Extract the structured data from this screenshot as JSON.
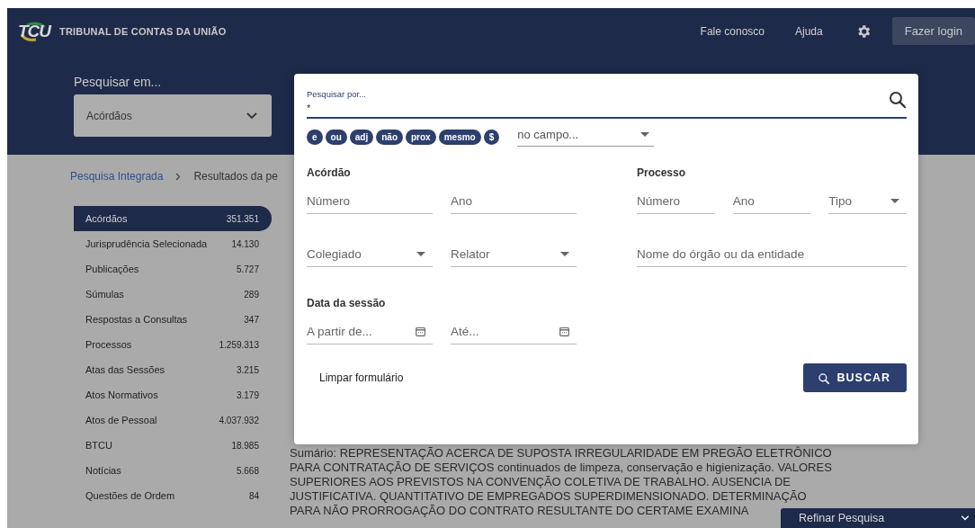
{
  "header": {
    "logo_mark": "TCU",
    "logo_text": "TRIBUNAL DE CONTAS DA UNIÃO",
    "links": [
      "Fale conosco",
      "Ajuda"
    ],
    "login_button": "Fazer login"
  },
  "search_scope": {
    "label": "Pesquisar em...",
    "value": "Acórdãos"
  },
  "breadcrumb": [
    {
      "label": "Pesquisa Integrada",
      "kind": "link"
    },
    {
      "label": "Resultados da pe",
      "kind": "current"
    }
  ],
  "sidebar": {
    "items": [
      {
        "label": "Acórdãos",
        "count": "351.351",
        "selected": true
      },
      {
        "label": "Jurisprudência Selecionada",
        "count": "14.130",
        "selected": false
      },
      {
        "label": "Publicações",
        "count": "5.727",
        "selected": false
      },
      {
        "label": "Súmulas",
        "count": "289",
        "selected": false
      },
      {
        "label": "Respostas a Consultas",
        "count": "347",
        "selected": false
      },
      {
        "label": "Processos",
        "count": "1.259.313",
        "selected": false
      },
      {
        "label": "Atas das Sessões",
        "count": "3.215",
        "selected": false
      },
      {
        "label": "Atos Normativos",
        "count": "3.179",
        "selected": false
      },
      {
        "label": "Atos de Pessoal",
        "count": "4.037.932",
        "selected": false
      },
      {
        "label": "BTCU",
        "count": "18.985",
        "selected": false
      },
      {
        "label": "Notícias",
        "count": "5.668",
        "selected": false
      },
      {
        "label": "Questões de Ordem",
        "count": "84",
        "selected": false
      }
    ]
  },
  "summary_lines": [
    "Sumário: REPRESENTAÇÃO ACERCA DE SUPOSTA IRREGULARIDADE EM PREGÃO ELETRÔNICO",
    "PARA CONTRATAÇÃO DE SERVIÇOS continuados de limpeza, conservação e higienização. VALORES",
    "SUPERIORES AOS PREVISTOS NA CONVENÇÃO COLETIVA DE TRABALHO. AUSENCIA DE",
    "JUSTIFICATIVA. QUANTITATIVO DE EMPREGADOS SUPERDIMENSIONADO. DETERMINAÇÃO",
    "PARA NÃO PRORROGAÇÃO DO CONTRATO RESULTANTE DO CERTAME EXAMINA"
  ],
  "modal": {
    "search": {
      "label": "Pesquisar por...",
      "value": "*"
    },
    "operators": [
      "e",
      "ou",
      "adj",
      "não",
      "prox",
      "mesmo",
      "$"
    ],
    "field_select": {
      "placeholder": "no campo..."
    },
    "groups": [
      {
        "title": "Acórdão",
        "rows": [
          [
            {
              "kind": "text",
              "placeholder": "Número"
            },
            {
              "kind": "text",
              "placeholder": "Ano"
            }
          ],
          [
            {
              "kind": "select",
              "placeholder": "Colegiado"
            },
            {
              "kind": "select",
              "placeholder": "Relator"
            }
          ]
        ]
      },
      {
        "title": "Processo",
        "rows": [
          [
            {
              "kind": "text",
              "placeholder": "Número"
            },
            {
              "kind": "text",
              "placeholder": "Ano"
            },
            {
              "kind": "select",
              "placeholder": "Tipo"
            }
          ],
          [
            {
              "kind": "text",
              "placeholder": "Nome do órgão ou da entidade"
            }
          ]
        ]
      },
      {
        "title": "Data da sessão",
        "rows": [
          [
            {
              "kind": "date",
              "placeholder": "A partir de..."
            },
            {
              "kind": "date",
              "placeholder": "Até..."
            }
          ]
        ]
      }
    ],
    "clear_button": "Limpar formulário",
    "submit_button": "BUSCAR"
  },
  "refine_panel": {
    "title": "Refinar Pesquisa"
  }
}
